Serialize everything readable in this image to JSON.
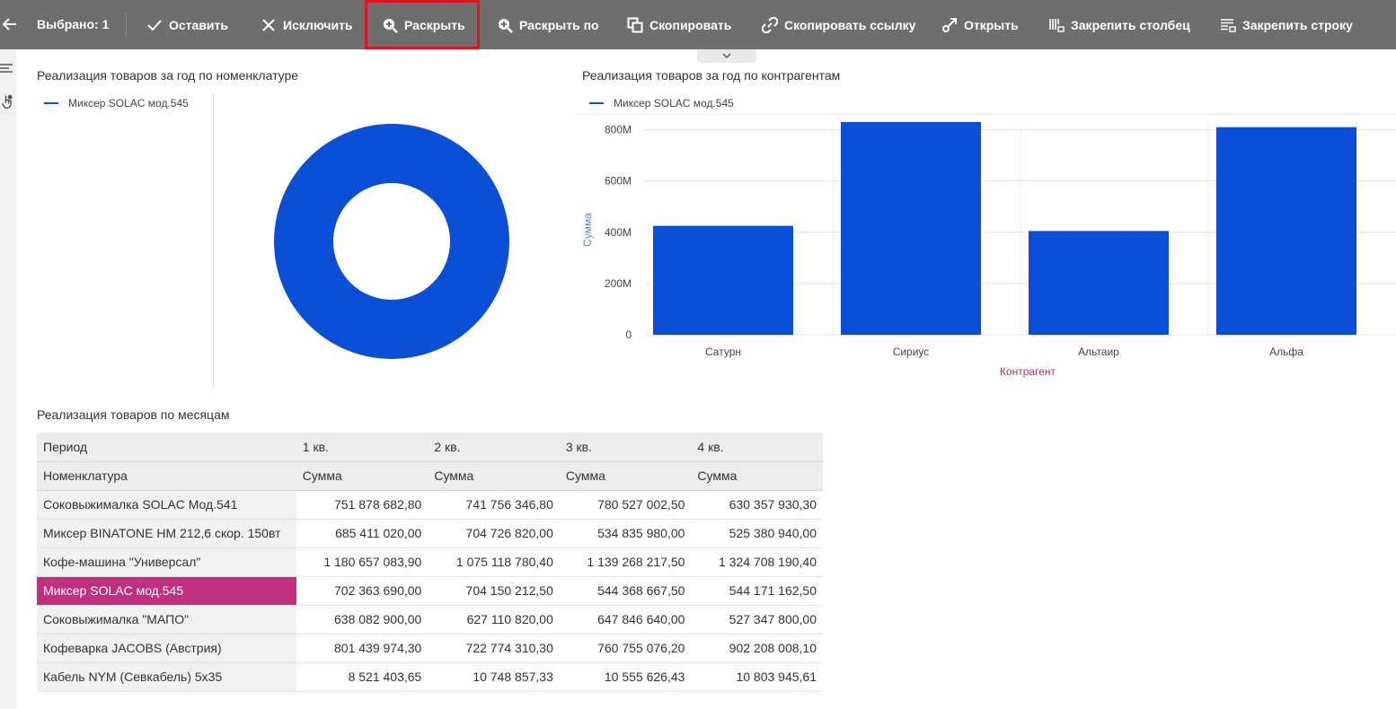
{
  "toolbar": {
    "selected_label": "Выбрано: 1",
    "buttons": [
      {
        "label": "Оставить",
        "icon": "check-icon"
      },
      {
        "label": "Исключить",
        "icon": "close-icon"
      },
      {
        "label": "Раскрыть",
        "icon": "zoom-in-icon",
        "highlighted": true
      },
      {
        "label": "Раскрыть по",
        "icon": "zoom-in-icon"
      },
      {
        "label": "Скопировать",
        "icon": "copy-icon"
      },
      {
        "label": "Скопировать ссылку",
        "icon": "link-icon"
      },
      {
        "label": "Открыть",
        "icon": "open-link-icon"
      },
      {
        "label": "Закрепить столбец",
        "icon": "pin-column-icon"
      },
      {
        "label": "Закрепить строку",
        "icon": "pin-row-icon"
      }
    ],
    "highlight_color": "#e0141e"
  },
  "donut_panel": {
    "title": "Реализация товаров за год по номенклатуре",
    "legend": "Миксер SOLAC мод.545",
    "color": "#0b4fd6"
  },
  "bar_panel": {
    "title": "Реализация товаров за год по контрагентам",
    "legend": "Миксер SOLAC мод.545"
  },
  "chart_data": [
    {
      "type": "pie",
      "title": "Реализация товаров за год по номенклатуре",
      "labels": [
        "Миксер SOLAC мод.545"
      ],
      "values": [
        2495053732.5
      ],
      "donut": true
    },
    {
      "type": "bar",
      "title": "Реализация товаров за год по контрагентам",
      "categories": [
        "Сатурн",
        "Сириус",
        "Альтаир",
        "Альфа"
      ],
      "series": [
        {
          "name": "Миксер SOLAC мод.545",
          "values": [
            425,
            830,
            405,
            810
          ]
        }
      ],
      "xlabel": "Контрагент",
      "ylabel": "Сумма",
      "yticks": [
        "0",
        "200M",
        "400M",
        "600M",
        "800M"
      ],
      "ylim": [
        0,
        830
      ],
      "grid": true,
      "legend": "top-left",
      "color": "#0b4fd6",
      "ylabel_color": "#4a90c9",
      "xlabel_color": "#a3366a"
    }
  ],
  "table": {
    "title": "Реализация товаров по месяцам",
    "header_row1": [
      "Период",
      "1 кв.",
      "2 кв.",
      "3 кв.",
      "4 кв."
    ],
    "header_row2": [
      "Номенклатура",
      "Сумма",
      "Сумма",
      "Сумма",
      "Сумма"
    ],
    "rows": [
      {
        "name": "Соковыжималка  SOLAC  Мод.541",
        "values": [
          "751 878 682,80",
          "741 756 346,80",
          "780 527 002,50",
          "630 357 930,30"
        ]
      },
      {
        "name": "Миксер BINATONE HM 212,6 скор. 150вт",
        "values": [
          "685 411 020,00",
          "704 726 820,00",
          "534 835 980,00",
          "525 380 940,00"
        ]
      },
      {
        "name": "Кофе-машина \"Универсал\"",
        "values": [
          "1 180 657 083,90",
          "1 075 118 780,40",
          "1 139 268 217,50",
          "1 324 708 190,40"
        ]
      },
      {
        "name": "Миксер SOLAC мод.545",
        "values": [
          "702 363 690,00",
          "704 150 212,50",
          "544 368 667,50",
          "544 171 162,50"
        ],
        "selected": true
      },
      {
        "name": "Соковыжималка \"МАПО\"",
        "values": [
          "638 082 900,00",
          "627 110 820,00",
          "647 846 640,00",
          "527 347 800,00"
        ]
      },
      {
        "name": "Кофеварка JACOBS (Австрия)",
        "values": [
          "801 439 974,30",
          "722 774 310,30",
          "760 755 076,20",
          "902 208 008,10"
        ]
      },
      {
        "name": "Кабель NYM (Севкабель) 5х35",
        "values": [
          "8 521 403,65",
          "10 748 857,33",
          "10 555 626,43",
          "10 803 945,61"
        ]
      }
    ],
    "selected_color": "#c0307f"
  }
}
